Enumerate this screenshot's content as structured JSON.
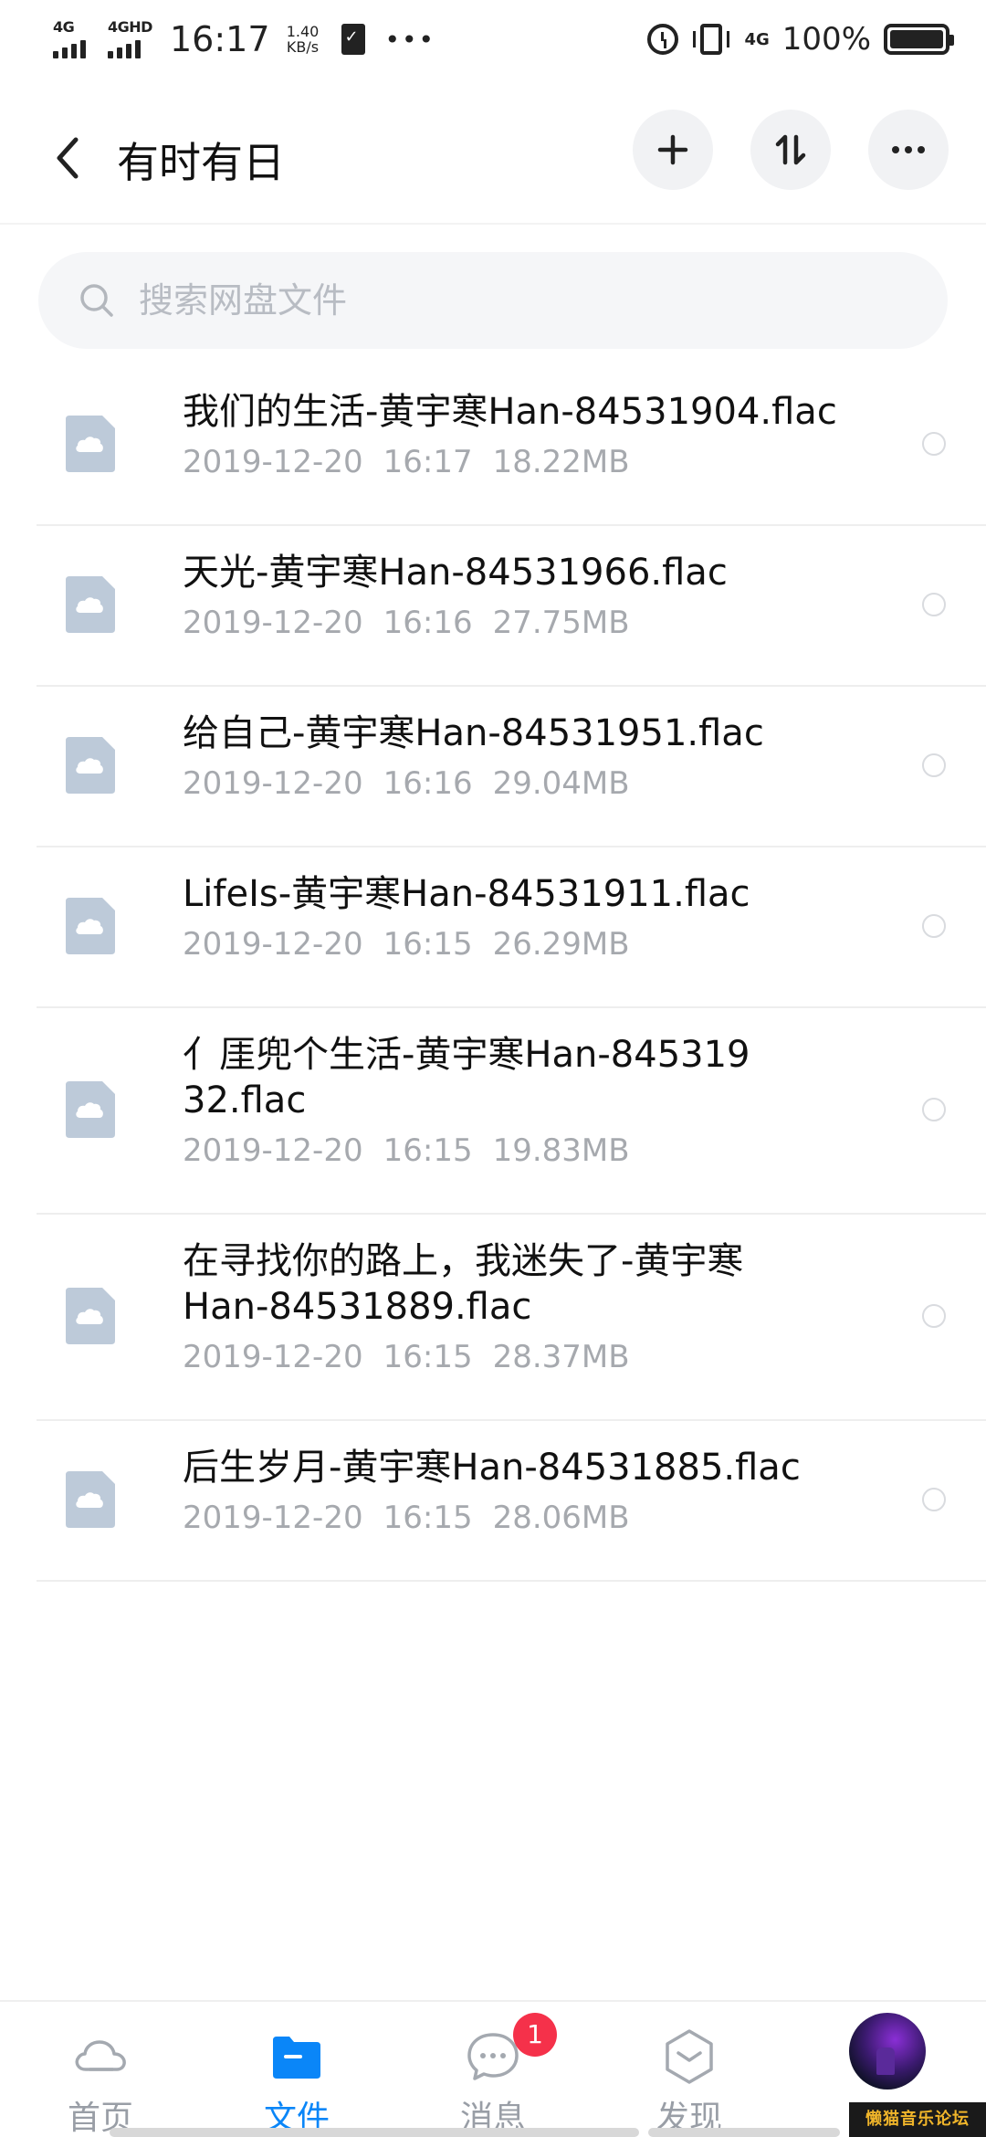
{
  "status_bar": {
    "signal1_label": "4G",
    "signal2_label": "4GHD",
    "time": "16:17",
    "speed_value": "1.40",
    "speed_unit": "KB/s",
    "network": "4G",
    "battery_percent": "100%",
    "icons": [
      "signal-icon",
      "clipboard-check-icon",
      "more-dots-icon",
      "alarm-icon",
      "vibrate-icon",
      "battery-icon"
    ]
  },
  "header": {
    "title": "有时有日",
    "icons": [
      "back-arrow-icon",
      "plus-icon",
      "sort-icon",
      "more-icon"
    ]
  },
  "search": {
    "placeholder": "搜索网盘文件"
  },
  "files": [
    {
      "name": "我们的生活-黄宇寒Han-84531904.flac",
      "date": "2019-12-20",
      "time": "16:17",
      "size": "18.22MB"
    },
    {
      "name": "天光-黄宇寒Han-84531966.flac",
      "date": "2019-12-20",
      "time": "16:16",
      "size": "27.75MB"
    },
    {
      "name": "给自己-黄宇寒Han-84531951.flac",
      "date": "2019-12-20",
      "time": "16:16",
      "size": "29.04MB"
    },
    {
      "name": "LifeIs-黄宇寒Han-84531911.flac",
      "date": "2019-12-20",
      "time": "16:15",
      "size": "26.29MB"
    },
    {
      "name": "亻厓兜个生活-黄宇寒Han-84531932.flac",
      "date": "2019-12-20",
      "time": "16:15",
      "size": "19.83MB"
    },
    {
      "name": "在寻找你的路上，我迷失了-黄宇寒Han-84531889.flac",
      "date": "2019-12-20",
      "time": "16:15",
      "size": "28.37MB"
    },
    {
      "name": "后生岁月-黄宇寒Han-84531885.flac",
      "date": "2019-12-20",
      "time": "16:15",
      "size": "28.06MB"
    }
  ],
  "bottom_nav": {
    "items": [
      {
        "label": "首页",
        "icon": "cloud-home-icon",
        "active": false
      },
      {
        "label": "文件",
        "icon": "folder-icon",
        "active": true
      },
      {
        "label": "消息",
        "icon": "chat-bubble-icon",
        "active": false,
        "badge": "1"
      },
      {
        "label": "发现",
        "icon": "discover-hexagon-icon",
        "active": false
      }
    ],
    "avatar_icon": "avatar"
  },
  "watermark": "懒猫音乐论坛",
  "colors": {
    "accent": "#0a86f8",
    "badge": "#f5314a",
    "file_icon": "#bdcad9",
    "meta_text": "#a6a9ae",
    "search_bg": "#f5f6f8"
  }
}
